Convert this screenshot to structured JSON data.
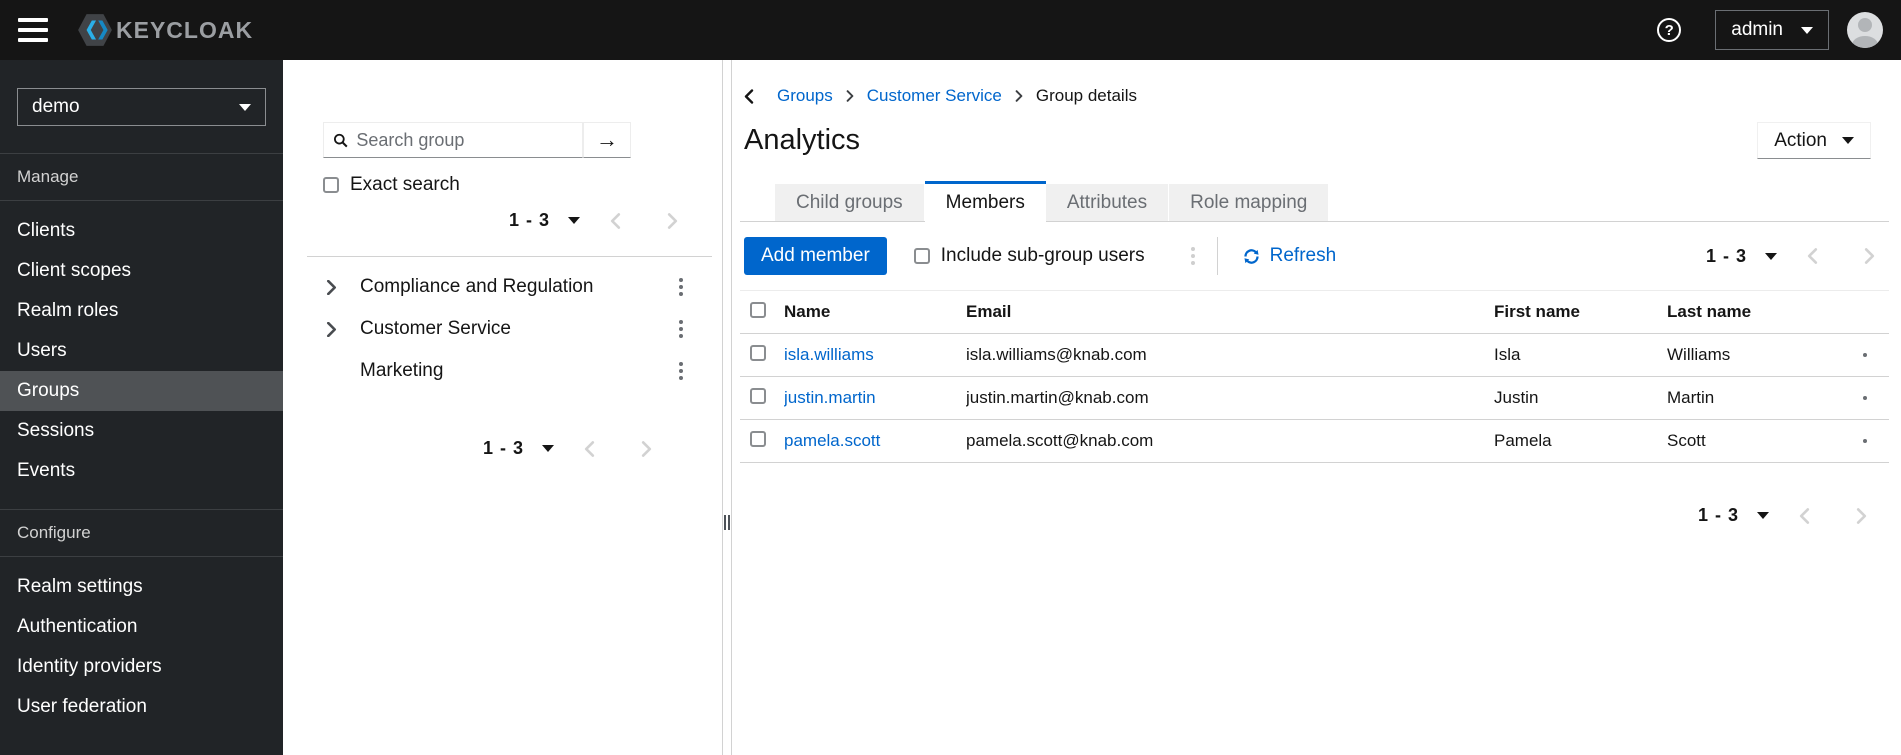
{
  "colors": {
    "primary": "#0066cc",
    "header_bg": "#151515",
    "sidebar_bg": "#212427",
    "sidebar_selected_bg": "#4f5255",
    "border": "#d2d2d2",
    "tab_inactive_bg": "#f0f0f0",
    "muted_text": "#6a6e73",
    "link": "#0066cc"
  },
  "icons": {
    "menu": "hamburger-icon",
    "help": "question-circle-icon",
    "user": "avatar-icon",
    "search": "magnifier-icon",
    "search_submit": "arrow-right-icon",
    "refresh": "sync-icon",
    "row_menu": "kebab-icon",
    "expand": "chevron-right-icon"
  },
  "header": {
    "brand": "KEYCLOAK",
    "user": "admin"
  },
  "sidebar": {
    "realm": "demo",
    "manage_label": "Manage",
    "manage_items": [
      {
        "label": "Clients"
      },
      {
        "label": "Client scopes"
      },
      {
        "label": "Realm roles"
      },
      {
        "label": "Users"
      },
      {
        "label": "Groups",
        "selected": true
      },
      {
        "label": "Sessions"
      },
      {
        "label": "Events"
      }
    ],
    "configure_label": "Configure",
    "configure_items": [
      {
        "label": "Realm settings"
      },
      {
        "label": "Authentication"
      },
      {
        "label": "Identity providers"
      },
      {
        "label": "User federation"
      }
    ]
  },
  "groups_panel": {
    "search_placeholder": "Search group",
    "exact_search_label": "Exact search",
    "pagination_top": "1 - 3",
    "tree": [
      {
        "name": "Compliance and Regulation",
        "expandable": true
      },
      {
        "name": "Customer Service",
        "expandable": true
      },
      {
        "name": "Marketing",
        "expandable": false
      }
    ],
    "pagination_bottom": "1 - 3"
  },
  "main": {
    "breadcrumb": {
      "items": [
        {
          "label": "Groups",
          "link": true
        },
        {
          "label": "Customer Service",
          "link": true
        },
        {
          "label": "Group details",
          "link": false
        }
      ]
    },
    "title": "Analytics",
    "action_label": "Action",
    "tabs": [
      {
        "label": "Child groups"
      },
      {
        "label": "Members",
        "active": true
      },
      {
        "label": "Attributes"
      },
      {
        "label": "Role mapping"
      }
    ],
    "toolbar": {
      "add_member_label": "Add member",
      "include_subgroups_label": "Include sub-group users",
      "refresh_label": "Refresh",
      "pagination": "1 - 3"
    },
    "table": {
      "headers": {
        "name": "Name",
        "email": "Email",
        "first": "First name",
        "last": "Last name"
      },
      "rows": [
        {
          "name": "isla.williams",
          "email": "isla.williams@knab.com",
          "first": "Isla",
          "last": "Williams"
        },
        {
          "name": "justin.martin",
          "email": "justin.martin@knab.com",
          "first": "Justin",
          "last": "Martin"
        },
        {
          "name": "pamela.scott",
          "email": "pamela.scott@knab.com",
          "first": "Pamela",
          "last": "Scott"
        }
      ]
    },
    "pagination_bottom": "1 - 3"
  }
}
